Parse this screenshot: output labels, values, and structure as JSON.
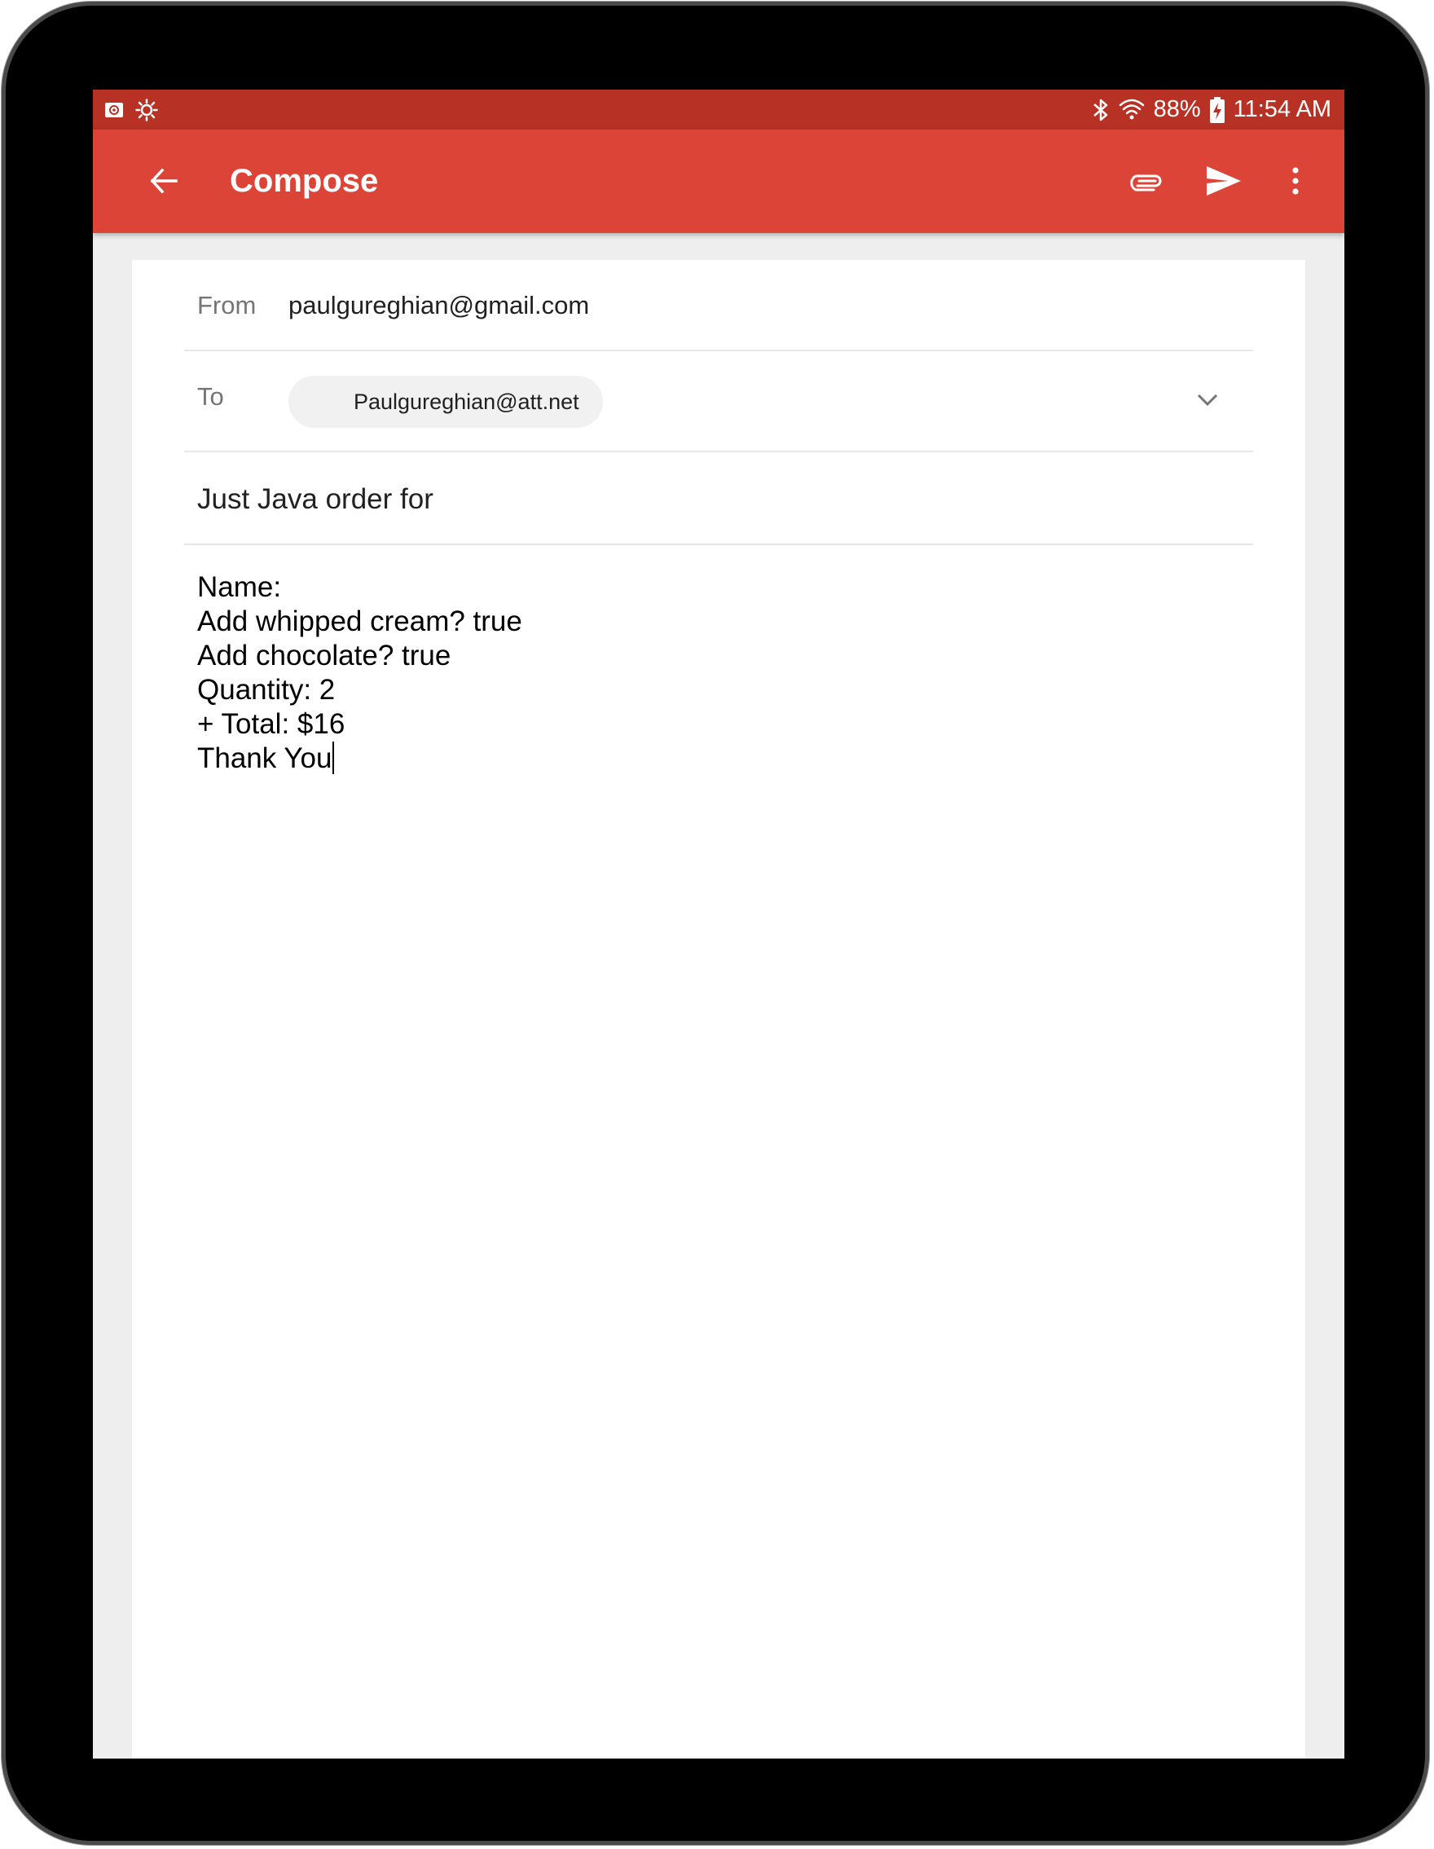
{
  "status_bar": {
    "battery": "88%",
    "time": "11:54 AM",
    "icons": [
      "notification-icon",
      "brightness-icon",
      "bluetooth-icon",
      "wifi-icon",
      "battery-charging-icon"
    ]
  },
  "app_bar": {
    "title": "Compose",
    "color": "#db4437",
    "actions": [
      "back-arrow-icon",
      "attach-icon",
      "send-icon",
      "more-vert-icon"
    ]
  },
  "compose": {
    "from_label": "From",
    "from_value": "paulgureghian@gmail.com",
    "to_label": "To",
    "recipient": "Paulgureghian@att.net",
    "subject": "Just Java order for",
    "body_lines": [
      "Name:",
      "Add whipped cream? true",
      "Add chocolate? true",
      "Quantity: 2",
      "+ Total: $16",
      "Thank You"
    ]
  }
}
